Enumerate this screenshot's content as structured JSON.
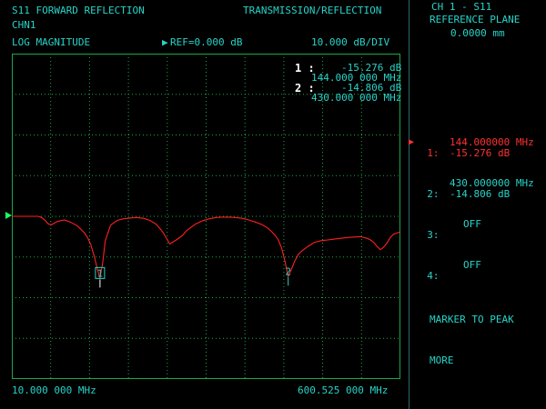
{
  "header": {
    "title_left": "S11 FORWARD REFLECTION",
    "title_right": "TRANSMISSION/REFLECTION",
    "channel": "CHN1",
    "format": "LOG MAGNITUDE",
    "ref_arrow": "▶",
    "ref_label": "REF=0.000 dB",
    "scale": "10.000 dB/DIV"
  },
  "marker_readout": [
    {
      "index": "1 :",
      "value": "-15.276 dB",
      "freq": "144.000 000 MHz"
    },
    {
      "index": "2 :",
      "value": "-14.806 dB",
      "freq": "430.000 000 MHz"
    }
  ],
  "footer": {
    "start_freq": "10.000 000 MHz",
    "stop_freq": "600.525 000 MHz"
  },
  "side_panel": {
    "title_line1": "CH 1 - S11",
    "title_line2": "REFERENCE PLANE",
    "title_line3": "0.0000 mm",
    "active_arrow": "▶",
    "softkeys": [
      {
        "label": "1:",
        "line1": "144.000000 MHz",
        "line2": "-15.276 dB"
      },
      {
        "label": "2:",
        "line1": "430.000000 MHz",
        "line2": "-14.806 dB"
      },
      {
        "label": "3:",
        "line1": "OFF",
        "line2": ""
      },
      {
        "label": "4:",
        "line1": "OFF",
        "line2": ""
      }
    ],
    "marker_to_peak": "MARKER TO PEAK",
    "more": "MORE"
  },
  "markers_on_trace": [
    {
      "label": "1",
      "freq_mhz": 144.0,
      "db": -15.276
    },
    {
      "label": "2",
      "freq_mhz": 430.0,
      "db": -14.806
    }
  ],
  "colors": {
    "text": "#27d3c8",
    "grid": "#1aa84a",
    "trace": "#ff2020",
    "active": "#ff3030"
  },
  "chart_data": {
    "type": "line",
    "x_unit": "MHz",
    "y_unit": "dB",
    "xlim": [
      10.0,
      600.525
    ],
    "ylim": [
      -40,
      40
    ],
    "ref_db": 0,
    "x": [
      10,
      20,
      30,
      40,
      50,
      55,
      60,
      65,
      70,
      80,
      90,
      100,
      110,
      120,
      125,
      130,
      135,
      140,
      144,
      148,
      152,
      160,
      170,
      180,
      190,
      200,
      210,
      220,
      230,
      240,
      250,
      260,
      270,
      275,
      280,
      285,
      290,
      300,
      310,
      320,
      330,
      340,
      350,
      360,
      370,
      380,
      390,
      400,
      410,
      415,
      420,
      425,
      430,
      435,
      440,
      445,
      450,
      460,
      470,
      480,
      490,
      500,
      510,
      520,
      530,
      540,
      550,
      555,
      560,
      565,
      570,
      575,
      580,
      585,
      590,
      600.525
    ],
    "y": [
      0,
      0,
      0,
      0,
      0,
      -0.3,
      -0.9,
      -1.8,
      -2.1,
      -1.2,
      -0.9,
      -1.5,
      -2.4,
      -4.0,
      -5.2,
      -7.0,
      -9.7,
      -13.0,
      -15.276,
      -11.5,
      -6.0,
      -2.2,
      -1.0,
      -0.6,
      -0.4,
      -0.3,
      -0.5,
      -1.0,
      -2.0,
      -4.0,
      -6.8,
      -5.8,
      -4.6,
      -3.6,
      -3.0,
      -2.4,
      -1.8,
      -1.1,
      -0.6,
      -0.3,
      -0.2,
      -0.2,
      -0.3,
      -0.5,
      -0.9,
      -1.4,
      -2.0,
      -3.0,
      -4.6,
      -5.8,
      -7.8,
      -11.0,
      -14.806,
      -13.0,
      -11.0,
      -9.5,
      -8.6,
      -7.4,
      -6.4,
      -6.0,
      -5.8,
      -5.6,
      -5.4,
      -5.2,
      -5.1,
      -5.0,
      -5.4,
      -5.8,
      -6.4,
      -7.4,
      -8.2,
      -7.6,
      -6.6,
      -5.2,
      -4.4,
      -3.8
    ],
    "grid": true
  }
}
